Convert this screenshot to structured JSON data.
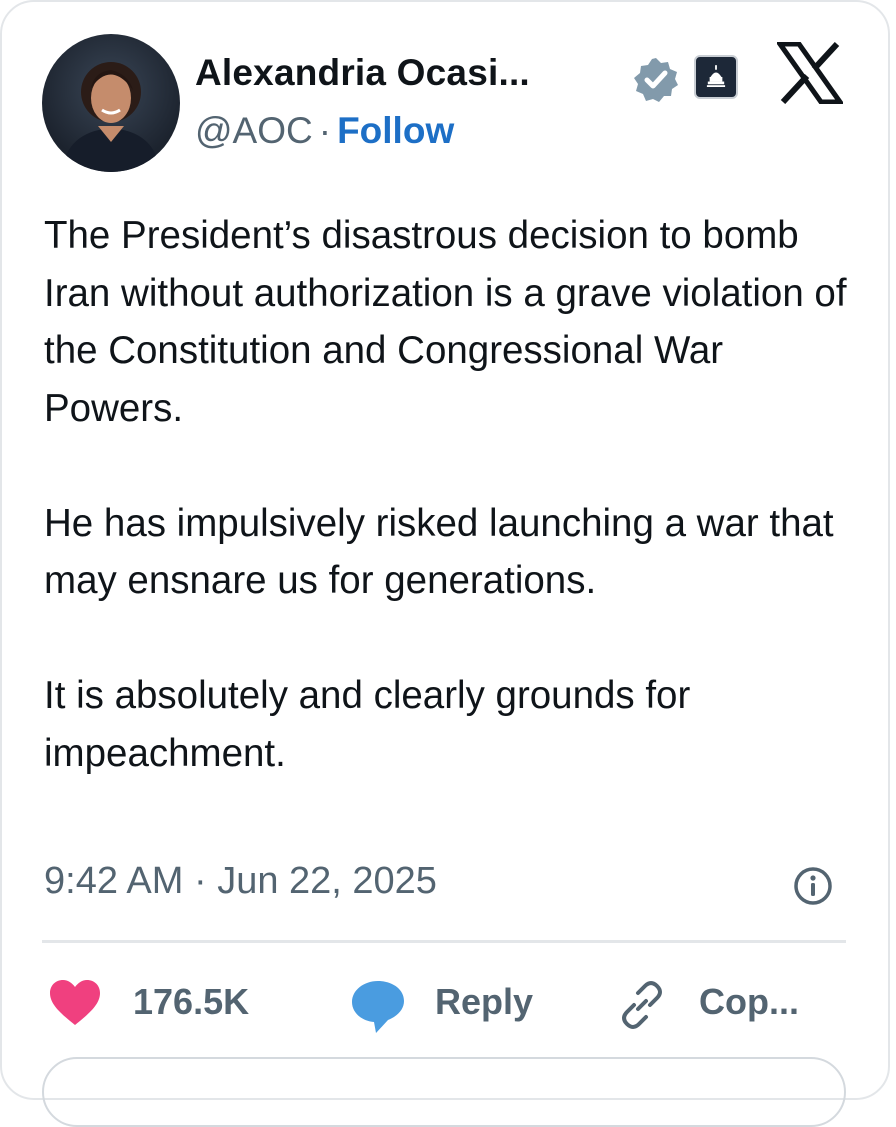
{
  "author": {
    "display_name": "Alexandria Ocasi...",
    "handle": "@AOC",
    "separator": "·",
    "follow_label": "Follow"
  },
  "tweet": {
    "paragraphs": [
      "The President’s disastrous decision to bomb Iran without authorization is a grave violation of the Constitution and Congressional War Powers.",
      "He has impulsively risked launching a war that may ensnare us for generations.",
      "It is absolutely and clearly grounds for impeachment."
    ],
    "timestamp": "9:42 AM · Jun 22, 2025"
  },
  "actions": {
    "likes": "176.5K",
    "reply_label": "Reply",
    "copy_label": "Cop..."
  },
  "colors": {
    "accent": "#1d6fc6",
    "like": "#f0407f",
    "reply": "#4a9ce0",
    "muted": "#536471",
    "verified": "#829aab"
  }
}
